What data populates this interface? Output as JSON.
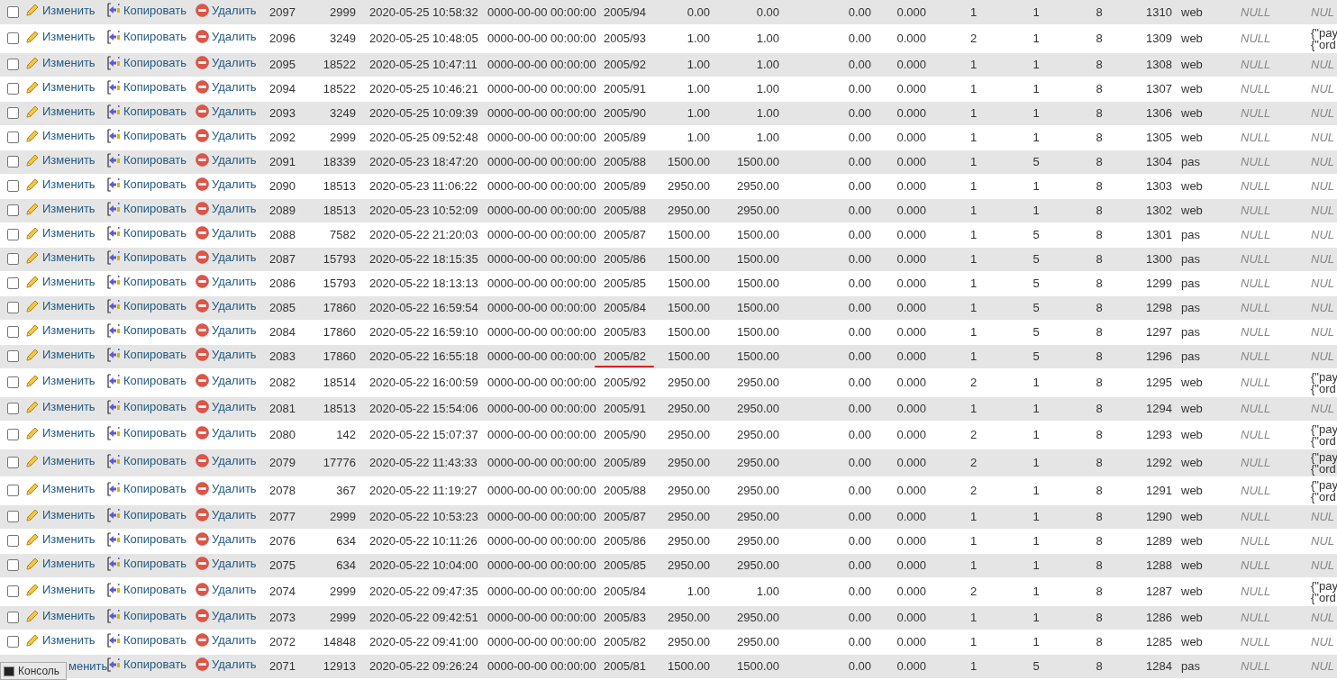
{
  "rows": [
    {
      "checked": false,
      "underlined": false,
      "actions": [
        "Изменить",
        "Копировать",
        "Удалить"
      ],
      "cells": [
        "2097",
        "2999",
        "2020-05-25 10:58:32",
        "0000-00-00 00:00:00",
        "2005/94",
        "0.00",
        "0.00",
        "0.00",
        "0.000",
        "1",
        "1",
        "8",
        "1310",
        "web",
        "NULL"
      ],
      "extra": {
        "kind": "null",
        "lines": [
          "NUL"
        ]
      }
    },
    {
      "checked": false,
      "underlined": false,
      "actions": [
        "Изменить",
        "Копировать",
        "Удалить"
      ],
      "cells": [
        "2096",
        "3249",
        "2020-05-25 10:48:05",
        "0000-00-00 00:00:00",
        "2005/93",
        "1.00",
        "1.00",
        "0.00",
        "0.000",
        "2",
        "1",
        "8",
        "1309",
        "web",
        "NULL"
      ],
      "extra": {
        "kind": "json",
        "lines": [
          "{\"pay",
          "{\"ord"
        ]
      }
    },
    {
      "checked": false,
      "underlined": false,
      "actions": [
        "Изменить",
        "Копировать",
        "Удалить"
      ],
      "cells": [
        "2095",
        "18522",
        "2020-05-25 10:47:11",
        "0000-00-00 00:00:00",
        "2005/92",
        "1.00",
        "1.00",
        "0.00",
        "0.000",
        "1",
        "1",
        "8",
        "1308",
        "web",
        "NULL"
      ],
      "extra": {
        "kind": "null",
        "lines": [
          "NUL"
        ]
      }
    },
    {
      "checked": false,
      "underlined": false,
      "actions": [
        "Изменить",
        "Копировать",
        "Удалить"
      ],
      "cells": [
        "2094",
        "18522",
        "2020-05-25 10:46:21",
        "0000-00-00 00:00:00",
        "2005/91",
        "1.00",
        "1.00",
        "0.00",
        "0.000",
        "1",
        "1",
        "8",
        "1307",
        "web",
        "NULL"
      ],
      "extra": {
        "kind": "null",
        "lines": [
          "NUL"
        ]
      }
    },
    {
      "checked": false,
      "underlined": false,
      "actions": [
        "Изменить",
        "Копировать",
        "Удалить"
      ],
      "cells": [
        "2093",
        "3249",
        "2020-05-25 10:09:39",
        "0000-00-00 00:00:00",
        "2005/90",
        "1.00",
        "1.00",
        "0.00",
        "0.000",
        "1",
        "1",
        "8",
        "1306",
        "web",
        "NULL"
      ],
      "extra": {
        "kind": "null",
        "lines": [
          "NUL"
        ]
      }
    },
    {
      "checked": false,
      "underlined": false,
      "actions": [
        "Изменить",
        "Копировать",
        "Удалить"
      ],
      "cells": [
        "2092",
        "2999",
        "2020-05-25 09:52:48",
        "0000-00-00 00:00:00",
        "2005/89",
        "1.00",
        "1.00",
        "0.00",
        "0.000",
        "1",
        "1",
        "8",
        "1305",
        "web",
        "NULL"
      ],
      "extra": {
        "kind": "null",
        "lines": [
          "NUL"
        ]
      }
    },
    {
      "checked": false,
      "underlined": false,
      "actions": [
        "Изменить",
        "Копировать",
        "Удалить"
      ],
      "cells": [
        "2091",
        "18339",
        "2020-05-23 18:47:20",
        "0000-00-00 00:00:00",
        "2005/88",
        "1500.00",
        "1500.00",
        "0.00",
        "0.000",
        "1",
        "5",
        "8",
        "1304",
        "pas",
        "NULL"
      ],
      "extra": {
        "kind": "null",
        "lines": [
          "NUL"
        ]
      }
    },
    {
      "checked": false,
      "underlined": false,
      "actions": [
        "Изменить",
        "Копировать",
        "Удалить"
      ],
      "cells": [
        "2090",
        "18513",
        "2020-05-23 11:06:22",
        "0000-00-00 00:00:00",
        "2005/89",
        "2950.00",
        "2950.00",
        "0.00",
        "0.000",
        "1",
        "1",
        "8",
        "1303",
        "web",
        "NULL"
      ],
      "extra": {
        "kind": "null",
        "lines": [
          "NUL"
        ]
      }
    },
    {
      "checked": false,
      "underlined": false,
      "actions": [
        "Изменить",
        "Копировать",
        "Удалить"
      ],
      "cells": [
        "2089",
        "18513",
        "2020-05-23 10:52:09",
        "0000-00-00 00:00:00",
        "2005/88",
        "2950.00",
        "2950.00",
        "0.00",
        "0.000",
        "1",
        "1",
        "8",
        "1302",
        "web",
        "NULL"
      ],
      "extra": {
        "kind": "null",
        "lines": [
          "NUL"
        ]
      }
    },
    {
      "checked": false,
      "underlined": false,
      "actions": [
        "Изменить",
        "Копировать",
        "Удалить"
      ],
      "cells": [
        "2088",
        "7582",
        "2020-05-22 21:20:03",
        "0000-00-00 00:00:00",
        "2005/87",
        "1500.00",
        "1500.00",
        "0.00",
        "0.000",
        "1",
        "5",
        "8",
        "1301",
        "pas",
        "NULL"
      ],
      "extra": {
        "kind": "null",
        "lines": [
          "NUL"
        ]
      }
    },
    {
      "checked": false,
      "underlined": false,
      "actions": [
        "Изменить",
        "Копировать",
        "Удалить"
      ],
      "cells": [
        "2087",
        "15793",
        "2020-05-22 18:15:35",
        "0000-00-00 00:00:00",
        "2005/86",
        "1500.00",
        "1500.00",
        "0.00",
        "0.000",
        "1",
        "5",
        "8",
        "1300",
        "pas",
        "NULL"
      ],
      "extra": {
        "kind": "null",
        "lines": [
          "NUL"
        ]
      }
    },
    {
      "checked": false,
      "underlined": false,
      "actions": [
        "Изменить",
        "Копировать",
        "Удалить"
      ],
      "cells": [
        "2086",
        "15793",
        "2020-05-22 18:13:13",
        "0000-00-00 00:00:00",
        "2005/85",
        "1500.00",
        "1500.00",
        "0.00",
        "0.000",
        "1",
        "5",
        "8",
        "1299",
        "pas",
        "NULL"
      ],
      "extra": {
        "kind": "null",
        "lines": [
          "NUL"
        ]
      }
    },
    {
      "checked": false,
      "underlined": false,
      "actions": [
        "Изменить",
        "Копировать",
        "Удалить"
      ],
      "cells": [
        "2085",
        "17860",
        "2020-05-22 16:59:54",
        "0000-00-00 00:00:00",
        "2005/84",
        "1500.00",
        "1500.00",
        "0.00",
        "0.000",
        "1",
        "5",
        "8",
        "1298",
        "pas",
        "NULL"
      ],
      "extra": {
        "kind": "null",
        "lines": [
          "NUL"
        ]
      }
    },
    {
      "checked": false,
      "underlined": false,
      "actions": [
        "Изменить",
        "Копировать",
        "Удалить"
      ],
      "cells": [
        "2084",
        "17860",
        "2020-05-22 16:59:10",
        "0000-00-00 00:00:00",
        "2005/83",
        "1500.00",
        "1500.00",
        "0.00",
        "0.000",
        "1",
        "5",
        "8",
        "1297",
        "pas",
        "NULL"
      ],
      "extra": {
        "kind": "null",
        "lines": [
          "NUL"
        ]
      }
    },
    {
      "checked": false,
      "underlined": true,
      "actions": [
        "Изменить",
        "Копировать",
        "Удалить"
      ],
      "cells": [
        "2083",
        "17860",
        "2020-05-22 16:55:18",
        "0000-00-00 00:00:00",
        "2005/82",
        "1500.00",
        "1500.00",
        "0.00",
        "0.000",
        "1",
        "5",
        "8",
        "1296",
        "pas",
        "NULL"
      ],
      "extra": {
        "kind": "null",
        "lines": [
          "NUL"
        ]
      }
    },
    {
      "checked": false,
      "underlined": false,
      "actions": [
        "Изменить",
        "Копировать",
        "Удалить"
      ],
      "cells": [
        "2082",
        "18514",
        "2020-05-22 16:00:59",
        "0000-00-00 00:00:00",
        "2005/92",
        "2950.00",
        "2950.00",
        "0.00",
        "0.000",
        "2",
        "1",
        "8",
        "1295",
        "web",
        "NULL"
      ],
      "extra": {
        "kind": "json",
        "lines": [
          "{\"pay",
          "{\"ord"
        ]
      }
    },
    {
      "checked": false,
      "underlined": false,
      "actions": [
        "Изменить",
        "Копировать",
        "Удалить"
      ],
      "cells": [
        "2081",
        "18513",
        "2020-05-22 15:54:06",
        "0000-00-00 00:00:00",
        "2005/91",
        "2950.00",
        "2950.00",
        "0.00",
        "0.000",
        "1",
        "1",
        "8",
        "1294",
        "web",
        "NULL"
      ],
      "extra": {
        "kind": "null",
        "lines": [
          "NUL"
        ]
      }
    },
    {
      "checked": false,
      "underlined": false,
      "actions": [
        "Изменить",
        "Копировать",
        "Удалить"
      ],
      "cells": [
        "2080",
        "142",
        "2020-05-22 15:07:37",
        "0000-00-00 00:00:00",
        "2005/90",
        "2950.00",
        "2950.00",
        "0.00",
        "0.000",
        "2",
        "1",
        "8",
        "1293",
        "web",
        "NULL"
      ],
      "extra": {
        "kind": "json",
        "lines": [
          "{\"pay",
          "{\"ord"
        ]
      }
    },
    {
      "checked": false,
      "underlined": false,
      "actions": [
        "Изменить",
        "Копировать",
        "Удалить"
      ],
      "cells": [
        "2079",
        "17776",
        "2020-05-22 11:43:33",
        "0000-00-00 00:00:00",
        "2005/89",
        "2950.00",
        "2950.00",
        "0.00",
        "0.000",
        "2",
        "1",
        "8",
        "1292",
        "web",
        "NULL"
      ],
      "extra": {
        "kind": "json",
        "lines": [
          "{\"pay",
          "{\"ord"
        ]
      }
    },
    {
      "checked": false,
      "underlined": false,
      "actions": [
        "Изменить",
        "Копировать",
        "Удалить"
      ],
      "cells": [
        "2078",
        "367",
        "2020-05-22 11:19:27",
        "0000-00-00 00:00:00",
        "2005/88",
        "2950.00",
        "2950.00",
        "0.00",
        "0.000",
        "2",
        "1",
        "8",
        "1291",
        "web",
        "NULL"
      ],
      "extra": {
        "kind": "json",
        "lines": [
          "{\"pay",
          "{\"ord"
        ]
      }
    },
    {
      "checked": false,
      "underlined": false,
      "actions": [
        "Изменить",
        "Копировать",
        "Удалить"
      ],
      "cells": [
        "2077",
        "2999",
        "2020-05-22 10:53:23",
        "0000-00-00 00:00:00",
        "2005/87",
        "2950.00",
        "2950.00",
        "0.00",
        "0.000",
        "1",
        "1",
        "8",
        "1290",
        "web",
        "NULL"
      ],
      "extra": {
        "kind": "null",
        "lines": [
          "NUL"
        ]
      }
    },
    {
      "checked": false,
      "underlined": false,
      "actions": [
        "Изменить",
        "Копировать",
        "Удалить"
      ],
      "cells": [
        "2076",
        "634",
        "2020-05-22 10:11:26",
        "0000-00-00 00:00:00",
        "2005/86",
        "2950.00",
        "2950.00",
        "0.00",
        "0.000",
        "1",
        "1",
        "8",
        "1289",
        "web",
        "NULL"
      ],
      "extra": {
        "kind": "null",
        "lines": [
          "NUL"
        ]
      }
    },
    {
      "checked": false,
      "underlined": false,
      "actions": [
        "Изменить",
        "Копировать",
        "Удалить"
      ],
      "cells": [
        "2075",
        "634",
        "2020-05-22 10:04:00",
        "0000-00-00 00:00:00",
        "2005/85",
        "2950.00",
        "2950.00",
        "0.00",
        "0.000",
        "1",
        "1",
        "8",
        "1288",
        "web",
        "NULL"
      ],
      "extra": {
        "kind": "null",
        "lines": [
          "NUL"
        ]
      }
    },
    {
      "checked": false,
      "underlined": false,
      "actions": [
        "Изменить",
        "Копировать",
        "Удалить"
      ],
      "cells": [
        "2074",
        "2999",
        "2020-05-22 09:47:35",
        "0000-00-00 00:00:00",
        "2005/84",
        "1.00",
        "1.00",
        "0.00",
        "0.000",
        "2",
        "1",
        "8",
        "1287",
        "web",
        "NULL"
      ],
      "extra": {
        "kind": "json",
        "lines": [
          "{\"pay",
          "{\"ord"
        ]
      }
    },
    {
      "checked": false,
      "underlined": false,
      "actions": [
        "Изменить",
        "Копировать",
        "Удалить"
      ],
      "cells": [
        "2073",
        "2999",
        "2020-05-22 09:42:51",
        "0000-00-00 00:00:00",
        "2005/83",
        "2950.00",
        "2950.00",
        "0.00",
        "0.000",
        "1",
        "1",
        "8",
        "1286",
        "web",
        "NULL"
      ],
      "extra": {
        "kind": "null",
        "lines": [
          "NUL"
        ]
      }
    },
    {
      "checked": false,
      "underlined": false,
      "actions": [
        "Изменить",
        "Копировать",
        "Удалить"
      ],
      "cells": [
        "2072",
        "14848",
        "2020-05-22 09:41:00",
        "0000-00-00 00:00:00",
        "2005/82",
        "2950.00",
        "2950.00",
        "0.00",
        "0.000",
        "1",
        "1",
        "8",
        "1285",
        "web",
        "NULL"
      ],
      "extra": {
        "kind": "null",
        "lines": [
          "NUL"
        ]
      }
    },
    {
      "underlined": false,
      "actions": [
        "менить",
        "Копировать",
        "Удалить"
      ],
      "cells": [
        "2071",
        "12913",
        "2020-05-22 09:26:24",
        "0000-00-00 00:00:00",
        "2005/81",
        "1500.00",
        "1500.00",
        "0.00",
        "0.000",
        "1",
        "5",
        "8",
        "1284",
        "pas",
        "NULL"
      ],
      "extra": {
        "kind": "null",
        "lines": [
          "NUL"
        ]
      }
    }
  ],
  "console": {
    "label": "Консоль"
  }
}
